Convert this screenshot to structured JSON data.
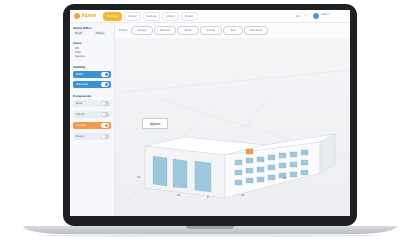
{
  "app": {
    "logo_text": "Alpine",
    "nav_tabs": [
      "Building",
      "Model",
      "Settings",
      "Library",
      "Report"
    ],
    "active_tab_index": 0,
    "top_right": {
      "lang": "EN",
      "help": "?",
      "user": "Admin"
    }
  },
  "sidebar": {
    "project_title": "Alpine Office",
    "project_meta": "Draft",
    "view_button": "Share",
    "section_views": "Views",
    "views": [
      "3D",
      "Plan",
      "Section"
    ],
    "section_visibility": "Visibility",
    "visibility_items": [
      {
        "label": "Walls",
        "color": "blue"
      },
      {
        "label": "Windows",
        "color": "blue"
      }
    ],
    "section_elements": "Components",
    "elements": [
      {
        "label": "Roof",
        "color": "gray"
      },
      {
        "label": "Floors",
        "color": "gray"
      },
      {
        "label": "Facade",
        "color": "orange"
      },
      {
        "label": "Doors",
        "color": "gray"
      }
    ]
  },
  "filters": {
    "label": "Phase",
    "chips": [
      "Design",
      "Review",
      "Build",
      "Finish",
      "Test",
      "Handover"
    ]
  },
  "scene": {
    "building_label": "Alpine",
    "dimension_labels": [
      "12",
      "10",
      "8",
      "15",
      "24"
    ]
  },
  "colors": {
    "accent": "#f7b733",
    "primary": "#3d8fd6",
    "highlight": "#f39a4a",
    "glass": "#9cc7dc"
  }
}
